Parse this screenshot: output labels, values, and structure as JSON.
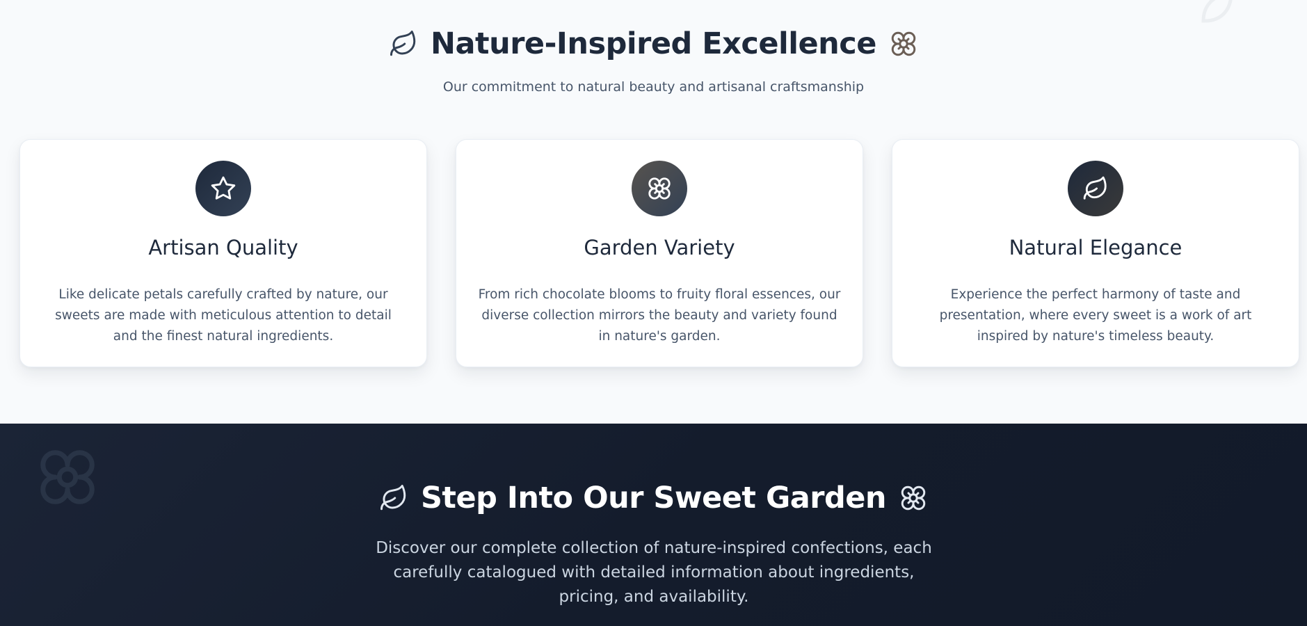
{
  "features": {
    "title": "Nature-Inspired Excellence",
    "title_icon_left": "leaf-icon",
    "title_icon_right": "flower-icon",
    "subtitle": "Our commitment to natural beauty and artisanal craftsmanship",
    "cards": [
      {
        "icon": "star-icon",
        "title": "Artisan Quality",
        "text": "Like delicate petals carefully crafted by nature, our sweets are made with meticulous attention to detail and the finest natural ingredients."
      },
      {
        "icon": "flower-icon",
        "title": "Garden Variety",
        "text": "From rich chocolate blooms to fruity floral essences, our diverse collection mirrors the beauty and variety found in nature's garden."
      },
      {
        "icon": "leaf-icon",
        "title": "Natural Elegance",
        "text": "Experience the perfect harmony of taste and presentation, where every sweet is a work of art inspired by nature's timeless beauty."
      }
    ]
  },
  "cta": {
    "title": "Step Into Our Sweet Garden",
    "title_icon_left": "leaf-icon",
    "title_icon_right": "flower-icon",
    "text": "Discover our complete collection of nature-inspired confections, each carefully catalogued with detailed information about ingredients, pricing, and availability."
  },
  "colors": {
    "navy": "#1e293b",
    "brown_accent": "#6b5e55",
    "slate_text": "#475569",
    "dark_bg": "#141c2c"
  }
}
